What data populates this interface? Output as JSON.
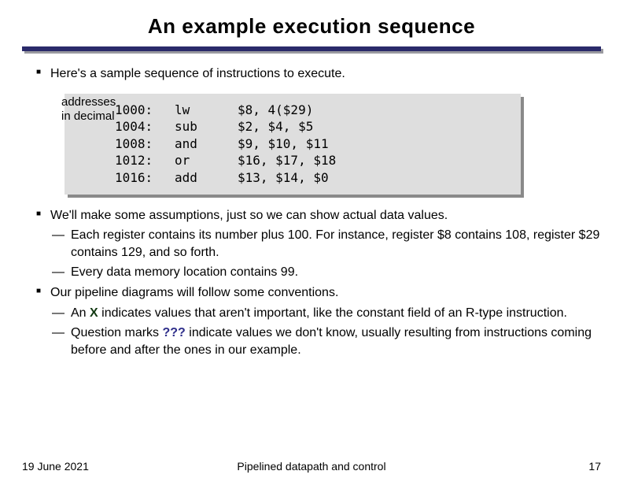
{
  "title": "An example execution sequence",
  "bullets": {
    "intro": "Here's a sample sequence of instructions to execute.",
    "assume_lead": "We'll make some assumptions, just so we can show actual data values.",
    "assume_sub1": "Each register contains its number plus 100. For instance, register $8 contains 108, register $29 contains 129, and so forth.",
    "assume_sub2": "Every data memory location contains 99.",
    "conv_lead": "Our pipeline diagrams will follow some conventions.",
    "conv_sub1_pre": "An ",
    "conv_sub1_x": "X",
    "conv_sub1_post": " indicates values that aren't important, like the constant field of an R-type instruction.",
    "conv_sub2_pre": "Question marks ",
    "conv_sub2_q": "???",
    "conv_sub2_post": " indicate values we don't know, usually resulting from instructions coming before and after the ones in our example."
  },
  "note_line1": "addresses",
  "note_line2": "in decimal",
  "code": [
    {
      "addr": "1000:",
      "op": "lw",
      "args": "$8, 4($29)"
    },
    {
      "addr": "1004:",
      "op": "sub",
      "args": "$2, $4, $5"
    },
    {
      "addr": "1008:",
      "op": "and",
      "args": "$9, $10, $11"
    },
    {
      "addr": "1012:",
      "op": "or",
      "args": "$16, $17, $18"
    },
    {
      "addr": "1016:",
      "op": "add",
      "args": "$13, $14, $0"
    }
  ],
  "footer": {
    "date": "19 June 2021",
    "title": "Pipelined datapath and control",
    "page": "17"
  }
}
